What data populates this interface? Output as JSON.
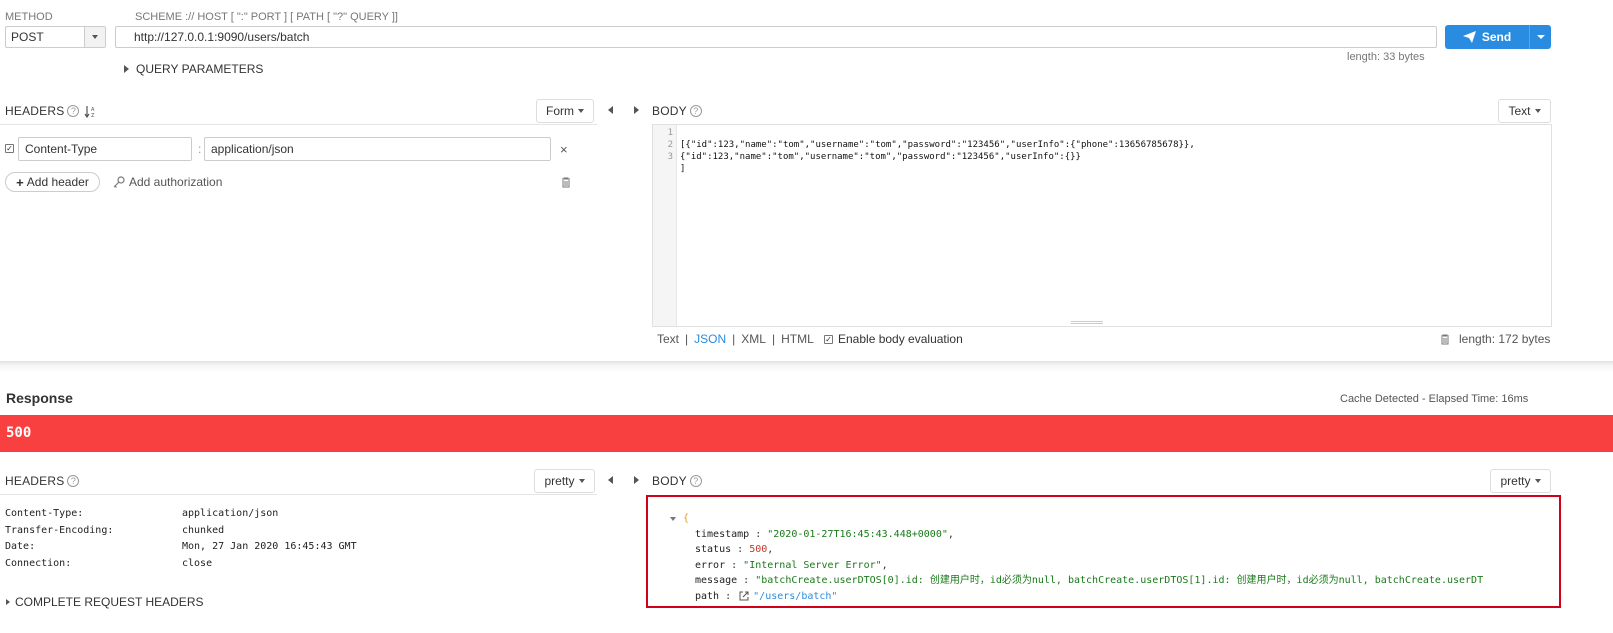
{
  "request": {
    "method_label": "METHOD",
    "method_value": "POST",
    "scheme_hint": "SCHEME :// HOST [ \":\" PORT ] [ PATH [ \"?\" QUERY ]]",
    "url": "http://127.0.0.1:9090/users/batch",
    "send_label": "Send",
    "length": "length: 33 bytes",
    "query_params_label": "QUERY PARAMETERS"
  },
  "req_headers": {
    "title": "HEADERS",
    "mode": "Form",
    "rows": [
      {
        "name": "Content-Type",
        "value": "application/json"
      }
    ],
    "add_header_label": "Add header",
    "add_auth_label": "Add authorization"
  },
  "req_body": {
    "title": "BODY",
    "mode": "Text",
    "lines": [
      "[{\"id\":123,\"name\":\"tom\",\"username\":\"tom\",\"password\":\"123456\",\"userInfo\":{\"phone\":13656785678}},",
      "{\"id\":123,\"name\":\"tom\",\"username\":\"tom\",\"password\":\"123456\",\"userInfo\":{}}",
      "]"
    ],
    "formats": [
      "Text",
      "JSON",
      "XML",
      "HTML"
    ],
    "active_format": "JSON",
    "enable_eval_label": "Enable body evaluation",
    "length": "length: 172 bytes"
  },
  "response": {
    "title": "Response",
    "cache_info": "Cache Detected - Elapsed Time: 16ms",
    "status_code": "500",
    "status_color": "#f94040"
  },
  "resp_headers": {
    "title": "HEADERS",
    "mode": "pretty",
    "rows": [
      {
        "name": "Content-Type:",
        "value": "application/json"
      },
      {
        "name": "Transfer-Encoding:",
        "value": "chunked"
      },
      {
        "name": "Date:",
        "value": "Mon, 27 Jan 2020 16:45:43 GMT"
      },
      {
        "name": "Connection:",
        "value": "close"
      }
    ],
    "complete_label": "COMPLETE REQUEST HEADERS"
  },
  "resp_body": {
    "title": "BODY",
    "mode": "pretty",
    "open_brace": "{",
    "fields": {
      "timestamp": {
        "key": "timestamp",
        "value": "\"2020-01-27T16:45:43.448+0000\"",
        "suffix": ","
      },
      "status": {
        "key": "status",
        "value": "500",
        "suffix": ","
      },
      "error": {
        "key": "error",
        "value": "\"Internal Server Error\"",
        "suffix": ","
      },
      "message": {
        "key": "message",
        "value": "\"batchCreate.userDTOS[0].id: 创建用户时，id必须为null, batchCreate.userDTOS[1].id: 创建用户时，id必须为null, batchCreate.userDT",
        "suffix": ""
      },
      "path": {
        "key": "path",
        "value": "\"/users/batch\"",
        "suffix": ""
      }
    }
  },
  "colors": {
    "accent": "#2a8ce0",
    "highlight_border": "#d0021b",
    "string": "#1a7a1a",
    "number": "#c0392b"
  }
}
